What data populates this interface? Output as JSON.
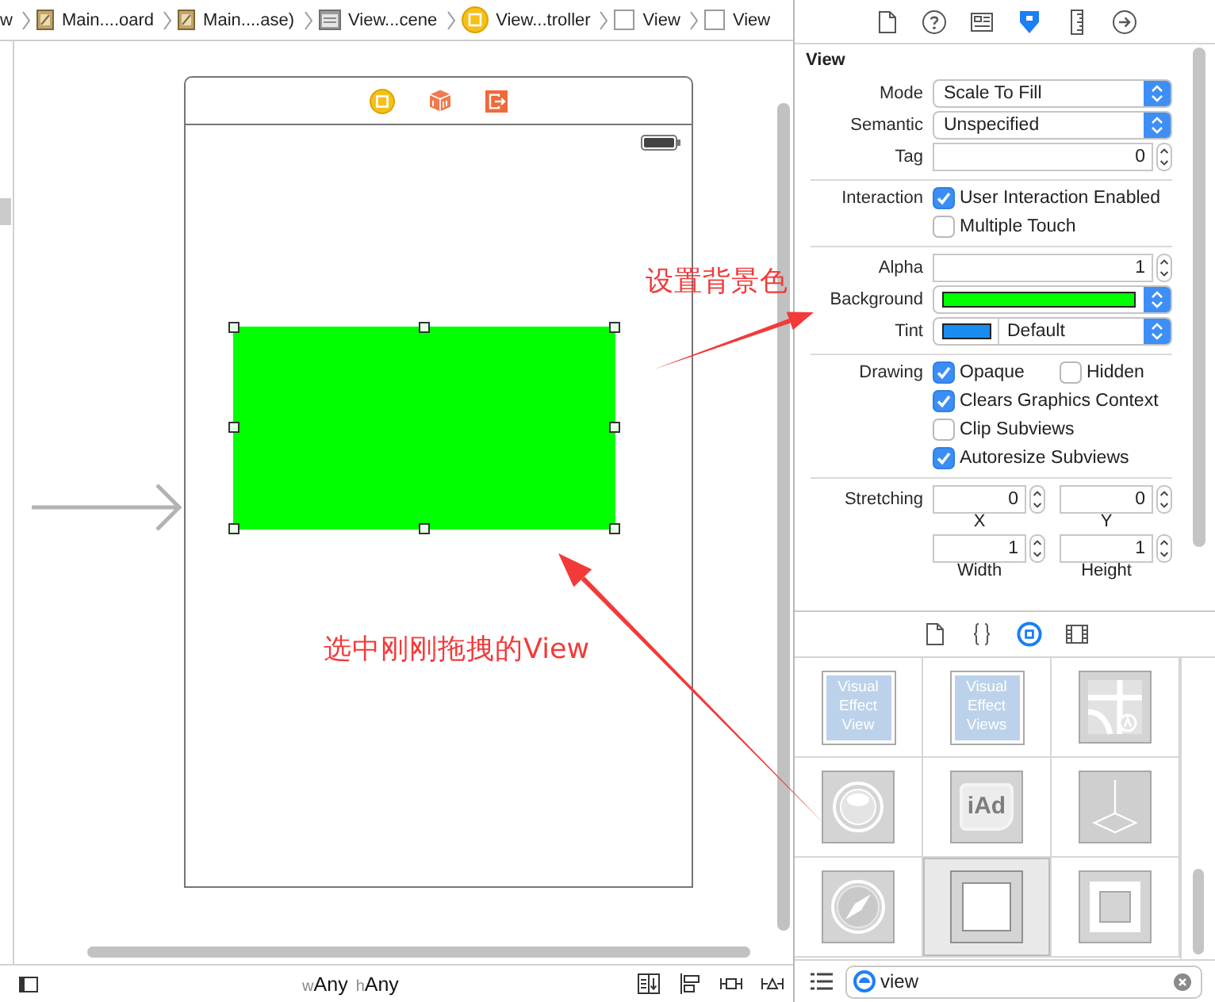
{
  "breadcrumb": [
    {
      "kind": "none",
      "label": "w"
    },
    {
      "kind": "storyboard",
      "label": "Main....oard"
    },
    {
      "kind": "storyboard",
      "label": "Main....ase)"
    },
    {
      "kind": "scene",
      "label": "View...cene"
    },
    {
      "kind": "controller",
      "label": "View...troller"
    },
    {
      "kind": "view",
      "label": "View"
    },
    {
      "kind": "view",
      "label": "View"
    }
  ],
  "annotations": [
    "设置背景色",
    "选中刚刚拖拽的View"
  ],
  "bottom_bar": {
    "size_classes": [
      {
        "prefix": "w",
        "value": "Any"
      },
      {
        "prefix": "h",
        "value": "Any"
      }
    ]
  },
  "inspector": {
    "tabs": [
      {
        "kind": "file",
        "selected": false
      },
      {
        "kind": "help",
        "selected": false
      },
      {
        "kind": "identity",
        "selected": false
      },
      {
        "kind": "attributes",
        "selected": true
      },
      {
        "kind": "size",
        "selected": false
      },
      {
        "kind": "connections",
        "selected": false
      }
    ],
    "title": "View",
    "groups": [
      {
        "rows": [
          {
            "kind": "popup",
            "label": "Mode",
            "value": "Scale To Fill"
          },
          {
            "kind": "popup",
            "label": "Semantic",
            "value": "Unspecified"
          },
          {
            "kind": "number",
            "label": "Tag",
            "value": "0"
          }
        ]
      },
      {
        "rows": [
          {
            "kind": "checks",
            "label": "Interaction",
            "options": [
              {
                "text": "User Interaction Enabled",
                "checked": true
              }
            ]
          },
          {
            "kind": "checks",
            "options": [
              {
                "text": "Multiple Touch",
                "checked": false
              }
            ]
          }
        ]
      },
      {
        "rows": [
          {
            "kind": "number",
            "label": "Alpha",
            "value": "1"
          },
          {
            "kind": "color",
            "label": "Background",
            "color": "#00ff00"
          },
          {
            "kind": "tint",
            "label": "Tint",
            "color": "#1a8cf0",
            "value": "Default"
          }
        ]
      },
      {
        "rows": [
          {
            "kind": "checks",
            "label": "Drawing",
            "options": [
              {
                "text": "Opaque",
                "checked": true
              },
              {
                "text": "Hidden",
                "checked": false
              }
            ]
          },
          {
            "kind": "checks",
            "options": [
              {
                "text": "Clears Graphics Context",
                "checked": true
              }
            ]
          },
          {
            "kind": "checks",
            "options": [
              {
                "text": "Clip Subviews",
                "checked": false
              }
            ]
          },
          {
            "kind": "checks",
            "options": [
              {
                "text": "Autoresize Subviews",
                "checked": true
              }
            ]
          }
        ]
      },
      {
        "rows": [
          {
            "kind": "pair",
            "label": "Stretching",
            "fields": [
              {
                "value": "0",
                "caption": "X"
              },
              {
                "value": "0",
                "caption": "Y"
              }
            ]
          },
          {
            "kind": "pair",
            "fields": [
              {
                "value": "1",
                "caption": "Width"
              },
              {
                "value": "1",
                "caption": "Height"
              }
            ]
          }
        ]
      }
    ]
  },
  "library": {
    "tabs": [
      {
        "kind": "file",
        "selected": false
      },
      {
        "kind": "code",
        "selected": false
      },
      {
        "kind": "object",
        "selected": true
      },
      {
        "kind": "media",
        "selected": false
      }
    ],
    "items": [
      {
        "kind": "text_tile",
        "label": "Visual Effect View",
        "selected": false
      },
      {
        "kind": "text_tile",
        "label": "Visual Effect Views",
        "selected": false
      },
      {
        "kind": "map",
        "selected": false
      },
      {
        "kind": "button",
        "selected": false
      },
      {
        "kind": "badge_tile",
        "label": "iAd",
        "selected": false
      },
      {
        "kind": "scene",
        "selected": false
      },
      {
        "kind": "web",
        "selected": false
      },
      {
        "kind": "view",
        "selected": true
      },
      {
        "kind": "container",
        "selected": false
      }
    ],
    "search": {
      "value": "view"
    }
  }
}
